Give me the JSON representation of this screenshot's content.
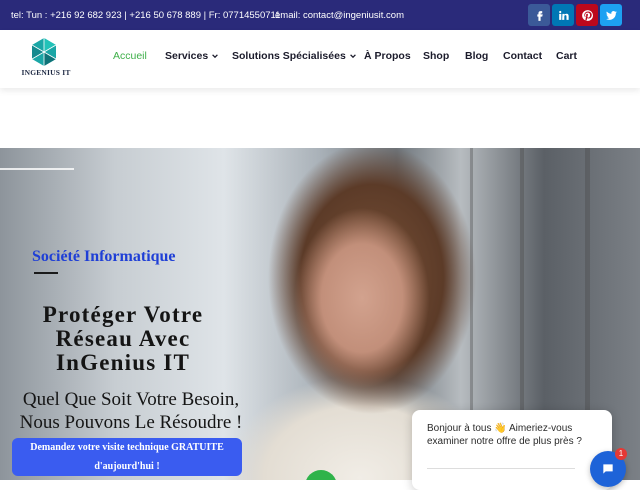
{
  "topbar": {
    "contact_line": "tel: Tun : +216 92 682 923 | +216 50 678 889 | Fr: 07714550711",
    "email": "email: contact@ingeniusit.com",
    "social": [
      "facebook-icon",
      "linkedin-icon",
      "pinterest-icon",
      "twitter-icon"
    ]
  },
  "header": {
    "logo_text": "INGENIUS IT",
    "nav": {
      "accueil": "Accueil",
      "services": "Services",
      "solutions": "Solutions Spécialisées",
      "apropos": "À Propos",
      "shop": "Shop",
      "blog": "Blog",
      "contact": "Contact",
      "cart": "Cart"
    }
  },
  "hero": {
    "eyebrow": "Société Informatique",
    "headline": "Protéger Votre Réseau Avec InGenius IT",
    "subhead": "Quel Que Soit Votre Besoin, Nous Pouvons Le Résoudre !",
    "cta": "Demandez votre visite technique GRATUITE d'aujourd'hui !"
  },
  "chat": {
    "message": "Bonjour à tous 👋 Aimeriez-vous examiner notre offre de plus près ?",
    "badge": "1"
  },
  "colors": {
    "topbar": "#2a2a7a",
    "active_nav": "#3fb04a",
    "eyebrow": "#1f3fd6",
    "cta": "#3a5cf0",
    "chat_button": "#1e63d8"
  }
}
